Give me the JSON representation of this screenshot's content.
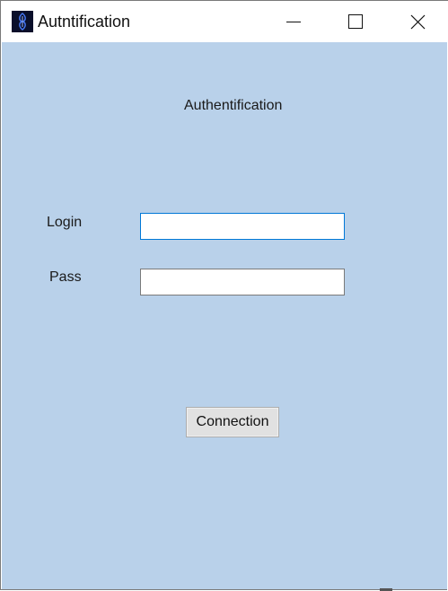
{
  "window": {
    "title": "Autntification",
    "icon": "app-logo-icon",
    "controls": {
      "minimize": "minimize-icon",
      "maximize": "maximize-icon",
      "close": "close-icon"
    }
  },
  "form": {
    "heading": "Authentification",
    "login_label": "Login",
    "login_value": "",
    "pass_label": "Pass",
    "pass_value": "",
    "connect_label": "Connection"
  },
  "colors": {
    "client_background": "#b9d1ea",
    "focus_border": "#0078d7",
    "titlebar": "#ffffff"
  }
}
